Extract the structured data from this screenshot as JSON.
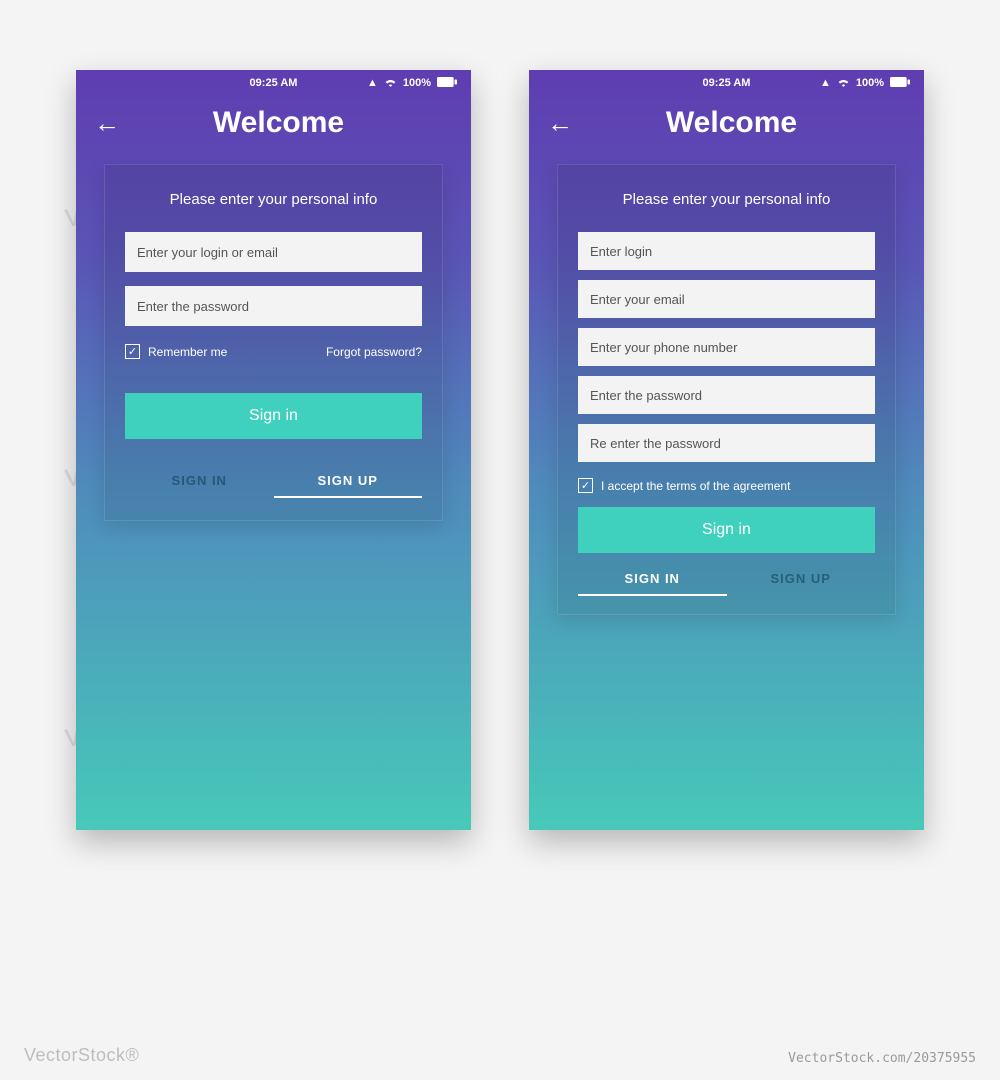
{
  "status": {
    "time": "09:25 AM",
    "battery": "100%"
  },
  "header": {
    "title": "Welcome"
  },
  "card": {
    "subtitle": "Please enter your personal info"
  },
  "screen1": {
    "fields": {
      "login": "Enter your login or email",
      "password": "Enter the password"
    },
    "remember": "Remember me",
    "forgot": "Forgot password?",
    "primary": "Sign in",
    "tab_signin": "SIGN IN",
    "tab_signup": "SIGN UP"
  },
  "screen2": {
    "fields": {
      "login": "Enter login",
      "email": "Enter your email",
      "phone": "Enter your phone number",
      "password": "Enter the password",
      "repassword": "Re enter the password"
    },
    "terms": "I accept the terms of the agreement",
    "primary": "Sign in",
    "tab_signin": "SIGN IN",
    "tab_signup": "SIGN UP"
  },
  "watermark": "vectorstock",
  "footer": {
    "brand": "VectorStock®",
    "imgid": "VectorStock.com/20375955"
  }
}
